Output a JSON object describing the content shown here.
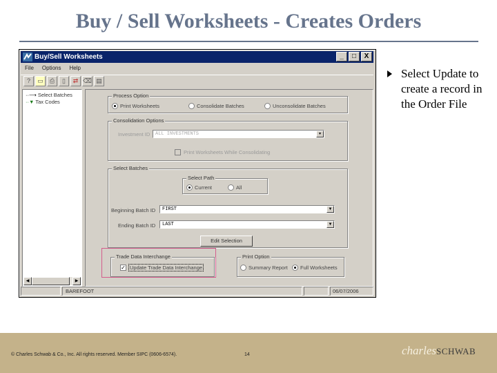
{
  "slide": {
    "title": "Buy / Sell Worksheets - Creates Orders",
    "bullet": "Select Update to create a record in the Order File"
  },
  "window": {
    "title": "Buy/Sell Worksheets",
    "buttons": {
      "minimize": "_",
      "maximize": "□",
      "close": "X"
    },
    "menu": [
      "File",
      "Options",
      "Help"
    ],
    "toolbar_icons": [
      "help-icon",
      "open-folder-icon",
      "print-icon",
      "clipboard-icon",
      "refresh-icon",
      "eraser-icon",
      "report-icon"
    ],
    "tree": [
      {
        "label": "Select Batches",
        "icon": "arrow-icon"
      },
      {
        "label": "Tax Codes",
        "icon": "green-triangle-icon"
      }
    ],
    "process_option": {
      "legend": "Process Option",
      "options": [
        "Print Worksheets",
        "Consolidate Batches",
        "Unconsolidate Batches"
      ],
      "selected": "Print Worksheets"
    },
    "consolidation_options": {
      "legend": "Consolidation Options",
      "investment_label": "Investment ID",
      "investment_value": "ALL INVESTMENTS",
      "checkbox_label": "Print Worksheets While Consolidating",
      "checked": false
    },
    "select_batches": {
      "legend": "Select Batches",
      "path_legend": "Select Path",
      "path_options": [
        "Current",
        "All"
      ],
      "path_selected": "Current",
      "begin_label": "Beginning Batch ID",
      "begin_value": "FIRST",
      "end_label": "Ending Batch ID",
      "end_value": "LAST",
      "edit_button": "Edit Selection"
    },
    "trade_data": {
      "legend": "Trade Data Interchange",
      "checkbox_label": "Update Trade Data Interchange",
      "checked": true
    },
    "print_option": {
      "legend": "Print Option",
      "options": [
        "Summary Report",
        "Full Worksheets"
      ],
      "selected": "Full Worksheets"
    },
    "status": {
      "user": "BAREFOOT",
      "date": "06/07/2006"
    }
  },
  "footer": {
    "copyright": "© Charles Schwab & Co., Inc.  All rights reserved. Member SIPC (0606-6574).",
    "page": "14",
    "logo_script": "charles",
    "logo_caps": "SCHWAB"
  }
}
